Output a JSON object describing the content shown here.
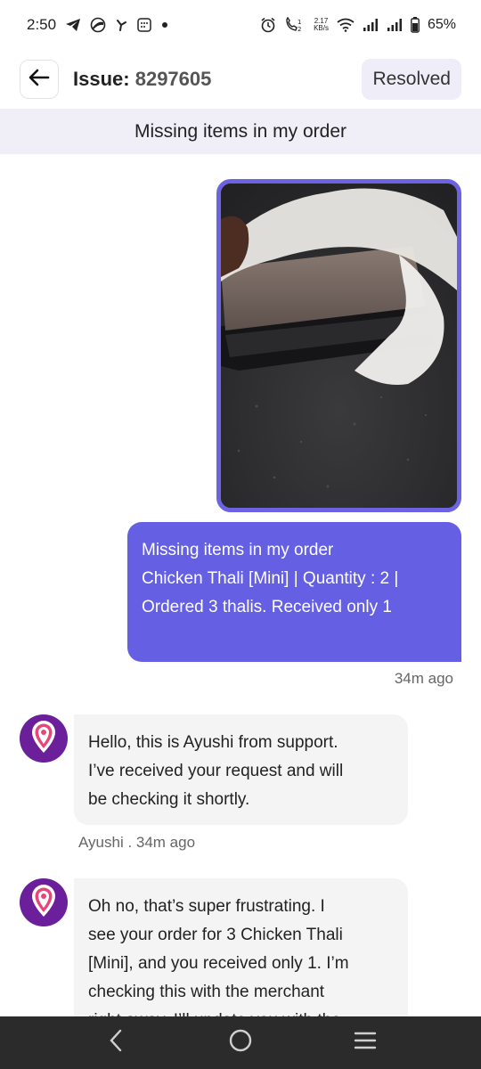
{
  "status_bar": {
    "time": "2:50",
    "net_speed_value": "2.17",
    "net_speed_unit": "KB/s",
    "battery": "65%",
    "icons": [
      "telegram-icon",
      "vpn-icon",
      "fan-icon",
      "calendar-icon",
      "dot-icon",
      "alarm-icon",
      "volte-call-icon",
      "wifi-icon",
      "signal-icon",
      "signal-icon",
      "battery-icon"
    ]
  },
  "header": {
    "issue_label": "Issue:",
    "issue_number": "8297605",
    "status": "Resolved"
  },
  "subject": "Missing items in my order",
  "messages": {
    "user": {
      "lines": [
        "Missing items in my order",
        "Chicken Thali [Mini] | Quantity : 2 |",
        "Ordered 3 thalis. Received only 1"
      ],
      "time": "34m ago"
    },
    "agent1": {
      "lines": [
        "Hello, this is Ayushi from support.",
        "I’ve received your request and will",
        "be checking it shortly."
      ],
      "meta": "Ayushi . 34m ago"
    },
    "agent2": {
      "lines": [
        "Oh no, that’s super frustrating. I",
        "see your order for 3 Chicken Thali",
        "[Mini], and you received only 1. I’m",
        "checking this with the merchant",
        "right away. I’ll update you with the"
      ]
    }
  },
  "colors": {
    "accent": "#645fe3",
    "subject_bg": "#f0eff8",
    "agent_bubble_bg": "#f4f4f4",
    "avatar_bg": "#6b1f9a",
    "nav_bg": "#2b2b2b"
  }
}
